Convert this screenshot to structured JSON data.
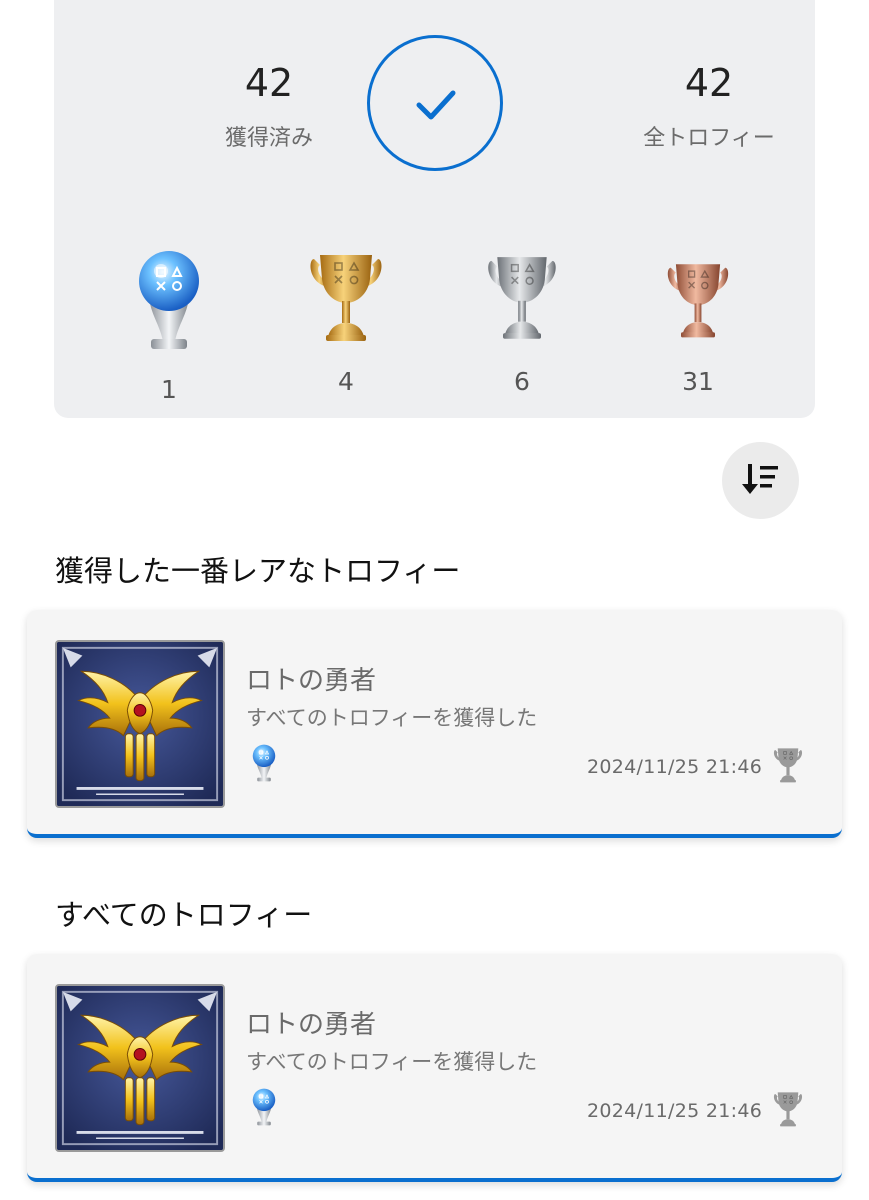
{
  "summary": {
    "earned_count": "42",
    "earned_label": "獲得済み",
    "total_count": "42",
    "total_label": "全トロフィー",
    "complete_icon": "check-circle-icon",
    "accent_color": "#0a6fcf"
  },
  "grades": [
    {
      "name": "platinum",
      "icon": "platinum-trophy-icon",
      "count": "1"
    },
    {
      "name": "gold",
      "icon": "gold-trophy-icon",
      "count": "4"
    },
    {
      "name": "silver",
      "icon": "silver-trophy-icon",
      "count": "6"
    },
    {
      "name": "bronze",
      "icon": "bronze-trophy-icon",
      "count": "31"
    }
  ],
  "sort_icon": "sort-descending-icon",
  "sections": {
    "rarest_title": "獲得した一番レアなトロフィー",
    "all_title": "すべてのトロフィー"
  },
  "rarest_trophy": {
    "name": "ロトの勇者",
    "description": "すべてのトロフィーを獲得した",
    "grade_icon": "platinum-trophy-icon",
    "earned_date": "2024/11/25  21:46",
    "status_icon": "trophy-earned-icon"
  },
  "trophy_list": [
    {
      "name": "ロトの勇者",
      "description": "すべてのトロフィーを獲得した",
      "grade_icon": "platinum-trophy-icon",
      "earned_date": "2024/11/25  21:46",
      "status_icon": "trophy-earned-icon"
    }
  ]
}
